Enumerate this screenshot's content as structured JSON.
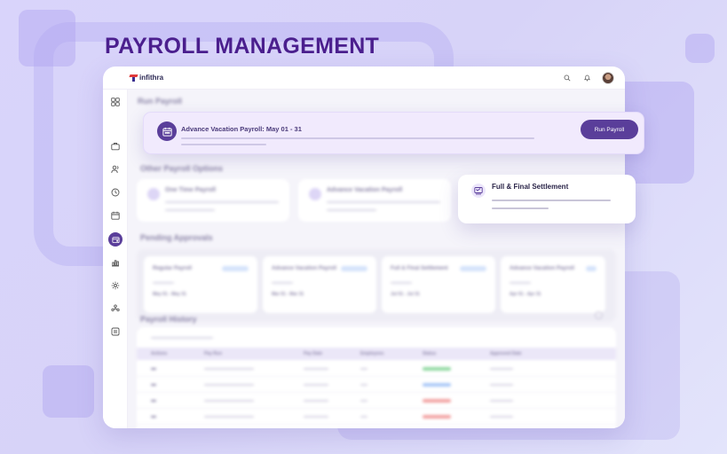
{
  "page": {
    "heading": "PAYROLL MANAGEMENT"
  },
  "app": {
    "logo_text": "infithra",
    "topbar_icons": [
      "search-icon",
      "bell-icon",
      "user-avatar"
    ],
    "sidebar_icons": [
      "dashboard-icon",
      "briefcase-icon",
      "users-icon",
      "clock-icon",
      "calendar-icon",
      "payroll-icon",
      "chart-icon",
      "gear-icon",
      "team-icon",
      "document-icon"
    ],
    "active_sidebar_item": "payroll-icon",
    "sections": {
      "run_payroll": "Run Payroll",
      "other_options": "Other Payroll Options",
      "pending_approvals": "Pending Approvals",
      "payroll_history": "Payroll History"
    },
    "run_banner": {
      "title": "Advance Vacation Payroll: May 01 - 31",
      "button": "Run Payroll"
    },
    "other_options": [
      {
        "label": "One Time Payroll"
      },
      {
        "label": "Advance Vacation Payroll"
      }
    ],
    "featured_option": {
      "label": "Full & Final Settlement"
    },
    "pending": [
      {
        "name": "Regular Payroll",
        "date": "May 01 - May 31"
      },
      {
        "name": "Advance Vacation Payroll",
        "date": "Mar 01 - Mar 31"
      },
      {
        "name": "Full & Final Settlement",
        "date": "Jul 01 - Jul 31"
      },
      {
        "name": "Advance Vacation Payroll",
        "date": "Apr 01 - Apr 31"
      }
    ],
    "history": {
      "headers": [
        "Actions",
        "Pay Run",
        "Pay Date",
        "Employees",
        "Status",
        "Approved Date"
      ],
      "status_colors": [
        "#8fd8a0",
        "#a9c8f7",
        "#f2a0a0",
        "#f2a0a0"
      ]
    },
    "colors": {
      "brand": "#5a3e9a",
      "heading": "#4b1f8e",
      "banner_bg": "#f1eafd"
    }
  }
}
